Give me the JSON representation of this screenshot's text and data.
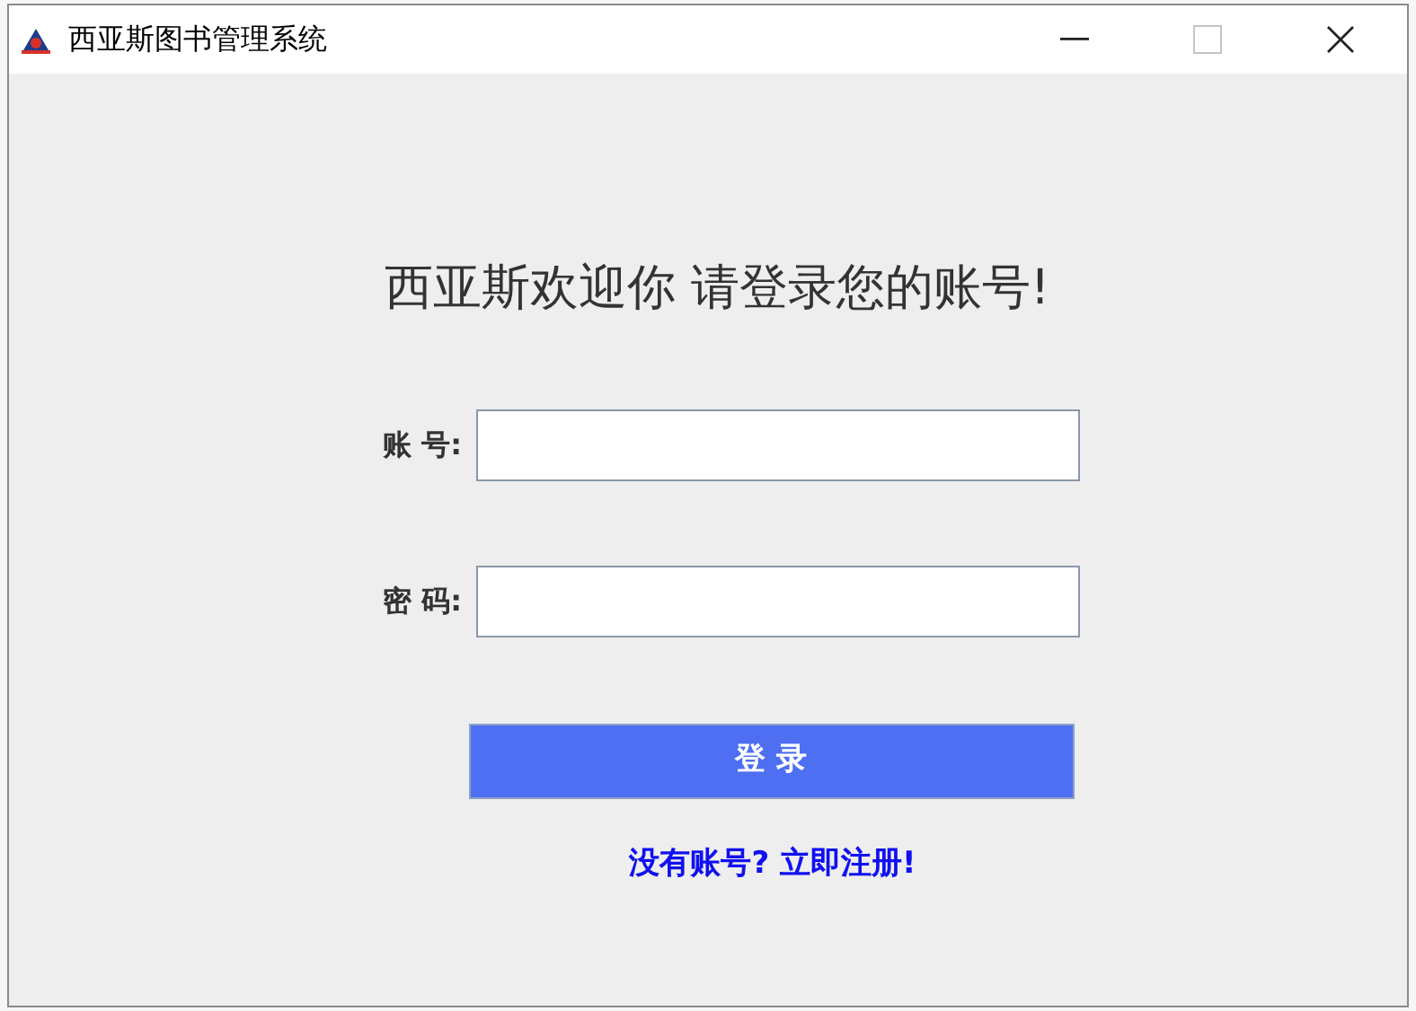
{
  "window": {
    "title": "西亚斯图书管理系统",
    "maximize_disabled": true
  },
  "heading": "西亚斯欢迎你 请登录您的账号!",
  "fields": [
    {
      "label": "账 号:"
    },
    {
      "label": "密 码:"
    }
  ],
  "login_button": "登 录",
  "register_link": "没有账号? 立即注册!"
}
